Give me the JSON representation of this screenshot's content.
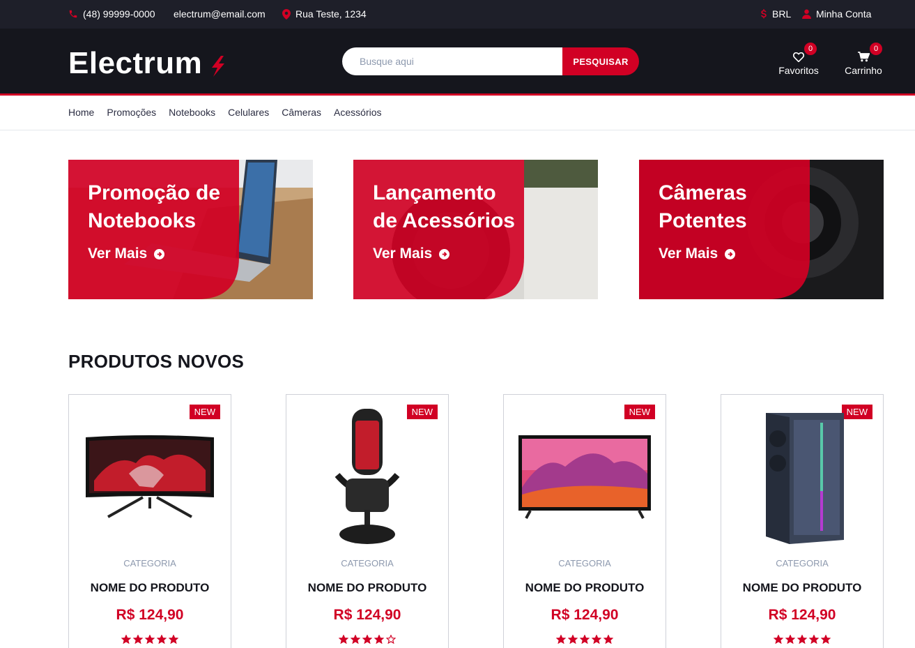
{
  "topbar": {
    "phone": "(48) 99999-0000",
    "email": "electrum@email.com",
    "address": "Rua Teste, 1234",
    "currency": "BRL",
    "account": "Minha Conta"
  },
  "header": {
    "logo": "Electrum",
    "search_placeholder": "Busque aqui",
    "search_button": "PESQUISAR",
    "favorites_label": "Favoritos",
    "favorites_count": "0",
    "cart_label": "Carrinho",
    "cart_count": "0"
  },
  "nav": [
    "Home",
    "Promoções",
    "Notebooks",
    "Celulares",
    "Câmeras",
    "Acessórios"
  ],
  "banners": [
    {
      "title": "Promoção de\nNotebooks",
      "link": "Ver Mais"
    },
    {
      "title": "Lançamento\nde Acessórios",
      "link": "Ver Mais"
    },
    {
      "title": "Câmeras\nPotentes",
      "link": "Ver Mais"
    }
  ],
  "section_title": "PRODUTOS NOVOS",
  "products": [
    {
      "badge": "NEW",
      "category": "CATEGORIA",
      "name": "NOME DO PRODUTO",
      "price": "R$ 124,90",
      "rating": 5,
      "icon": "curved-monitor-icon"
    },
    {
      "badge": "NEW",
      "category": "CATEGORIA",
      "name": "NOME DO PRODUTO",
      "price": "R$ 124,90",
      "rating": 4,
      "icon": "microphone-icon"
    },
    {
      "badge": "NEW",
      "category": "CATEGORIA",
      "name": "NOME DO PRODUTO",
      "price": "R$ 124,90",
      "rating": 5,
      "icon": "television-icon"
    },
    {
      "badge": "NEW",
      "category": "CATEGORIA",
      "name": "NOME DO PRODUTO",
      "price": "R$ 124,90",
      "rating": 5,
      "icon": "pc-case-icon"
    }
  ],
  "colors": {
    "accent": "#d10024",
    "dark": "#15161d",
    "topbar": "#1e1f29"
  }
}
